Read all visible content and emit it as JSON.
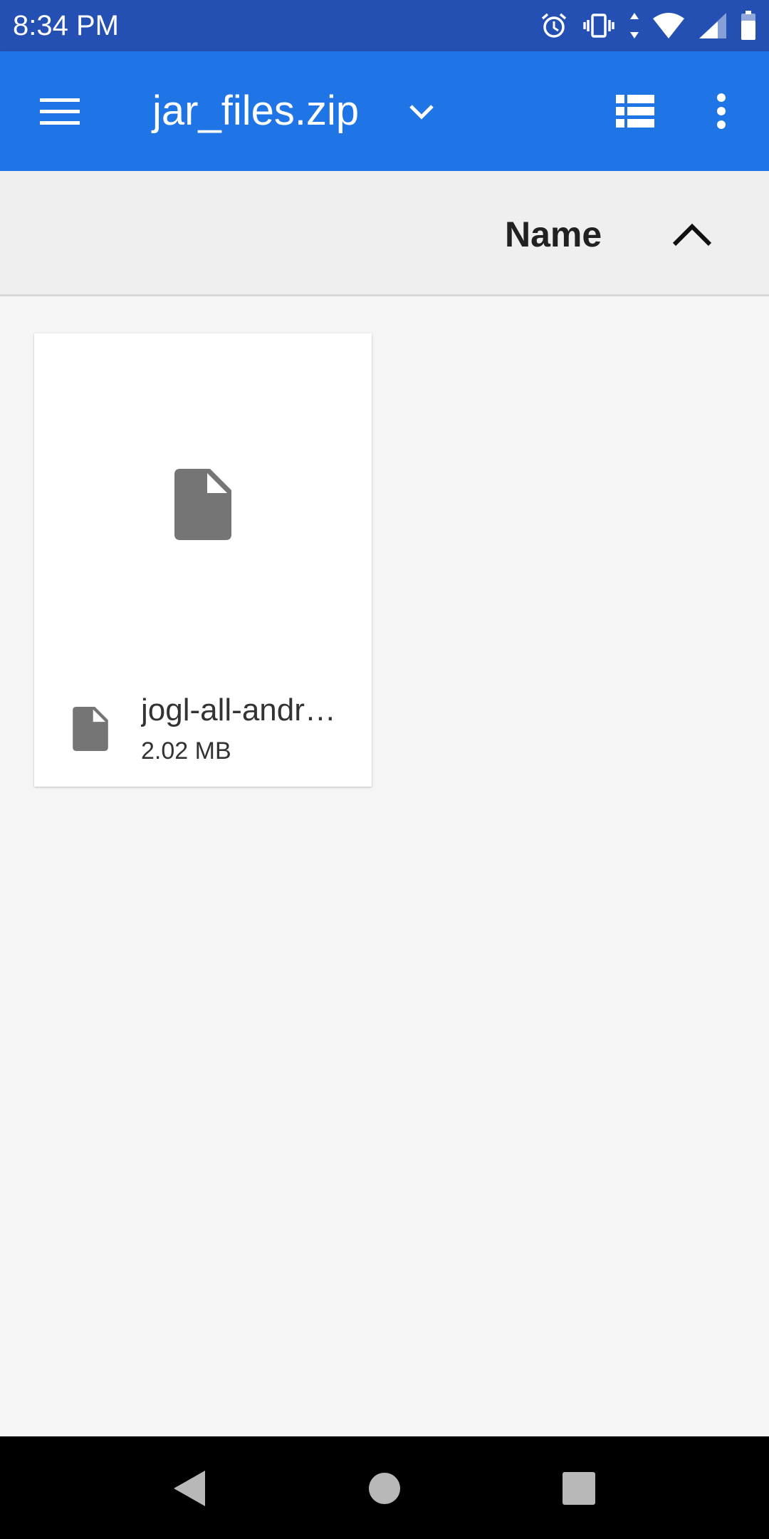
{
  "status_bar": {
    "time": "8:34 PM",
    "icons": [
      "alarm-icon",
      "vibrate-icon",
      "data-arrows-icon",
      "wifi-icon",
      "signal-icon",
      "battery-icon"
    ]
  },
  "app_bar": {
    "title": "jar_files.zip",
    "icons": {
      "menu": "menu-icon",
      "dropdown": "chevron-down-icon",
      "view_toggle": "list-view-icon",
      "overflow": "more-vert-icon"
    },
    "background": "#1f74e6"
  },
  "sort_bar": {
    "label": "Name",
    "direction_icon": "chevron-up-icon"
  },
  "files": [
    {
      "name": "jogl-all-andr…",
      "size": "2.02 MB",
      "icon": "file-icon"
    }
  ],
  "navigation_bar": {
    "icons": [
      "back-icon",
      "home-icon",
      "recents-icon"
    ]
  },
  "colors": {
    "status_bar": "#2450b4",
    "app_bar": "#1f74e6",
    "background": "#f5f5f5",
    "file_icon": "#757575"
  }
}
